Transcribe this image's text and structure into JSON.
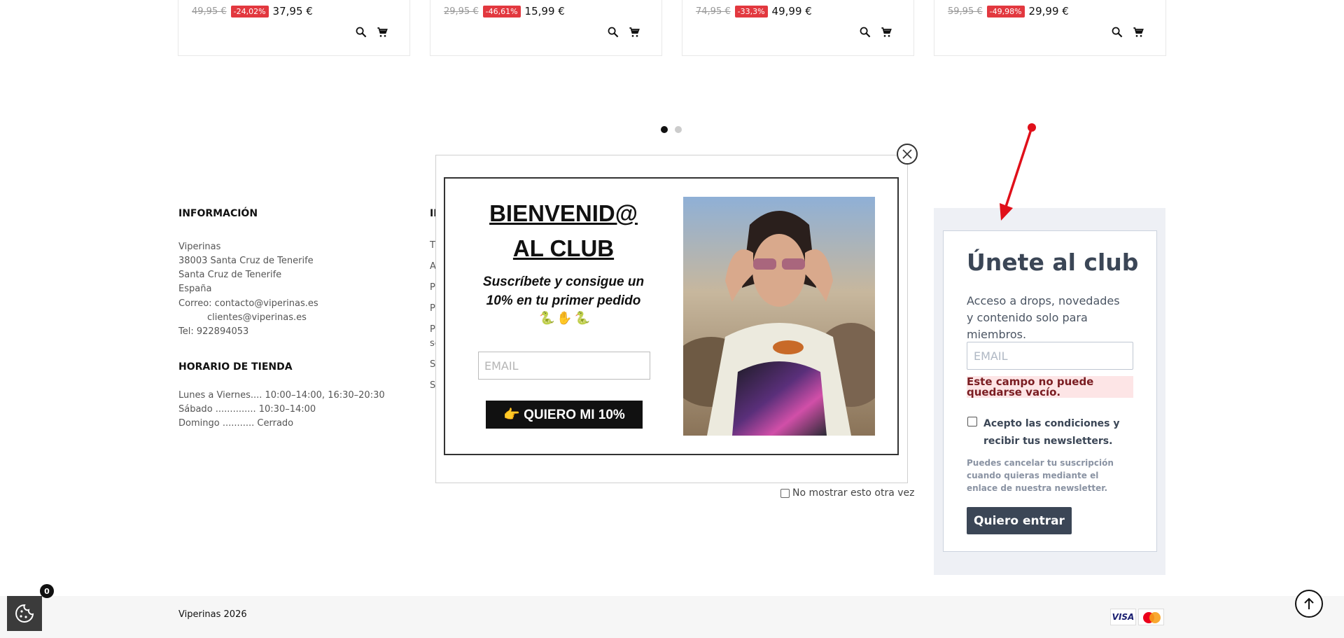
{
  "products": [
    {
      "old_price": "49,95 €",
      "discount": "-24,02%",
      "price": "37,95 €"
    },
    {
      "old_price": "29,95 €",
      "discount": "-46,61%",
      "price": "15,99 €"
    },
    {
      "old_price": "74,95 €",
      "discount": "-33,3%",
      "price": "49,99 €"
    },
    {
      "old_price": "59,95 €",
      "discount": "-49,98%",
      "price": "29,99 €"
    }
  ],
  "info": {
    "heading": "INFORMACIÓN",
    "lines": [
      "Viperinas",
      "38003 Santa Cruz de Tenerife",
      "Santa Cruz de Tenerife",
      "España",
      "Correo: contacto@viperinas.es",
      "clientes@viperinas.es",
      "Tel: 922894053"
    ]
  },
  "hours": {
    "heading": "HORARIO DE TIENDA",
    "lines": [
      "Lunes a Viernes.... 10:00–14:00, 16:30–20:30",
      "Sábado .............. 10:30–14:00",
      "Domingo ........... Cerrado"
    ]
  },
  "col2_peek": {
    "heading": "IN",
    "letters": [
      "T",
      "A",
      "P",
      "P",
      "P",
      "se",
      "S",
      "S"
    ]
  },
  "club": {
    "title": "Únete al club",
    "description": "Acceso a drops, novedades y contenido solo para miembros.",
    "email_placeholder": "EMAIL",
    "error": "Este campo no puede quedarse vacío.",
    "accept": "Acepto las condiciones y recibir tus newsletters.",
    "note": "Puedes cancelar tu suscripción cuando quieras mediante el enlace de nuestra newsletter.",
    "button": "Quiero entrar"
  },
  "popup": {
    "title_line1": "BIENVENID@",
    "title_line2": "AL CLUB",
    "subtitle": "Suscríbete y consigue un 10% en tu primer pedido",
    "emojis": "🐍✋🐍",
    "email_placeholder": "EMAIL",
    "button": "👉 QUIERO MI 10%",
    "dont_show": "No mostrar esto otra vez"
  },
  "footer": {
    "copyright": "Viperinas 2026",
    "visa": "VISA",
    "cookie_count": "0"
  },
  "colors": {
    "badge": "#e2383f",
    "club_button": "#3b4656",
    "arrow": "#e0101a"
  },
  "icons": [
    "search-icon",
    "cart-icon",
    "close-icon",
    "arrow-up-icon",
    "cookie-icon"
  ]
}
